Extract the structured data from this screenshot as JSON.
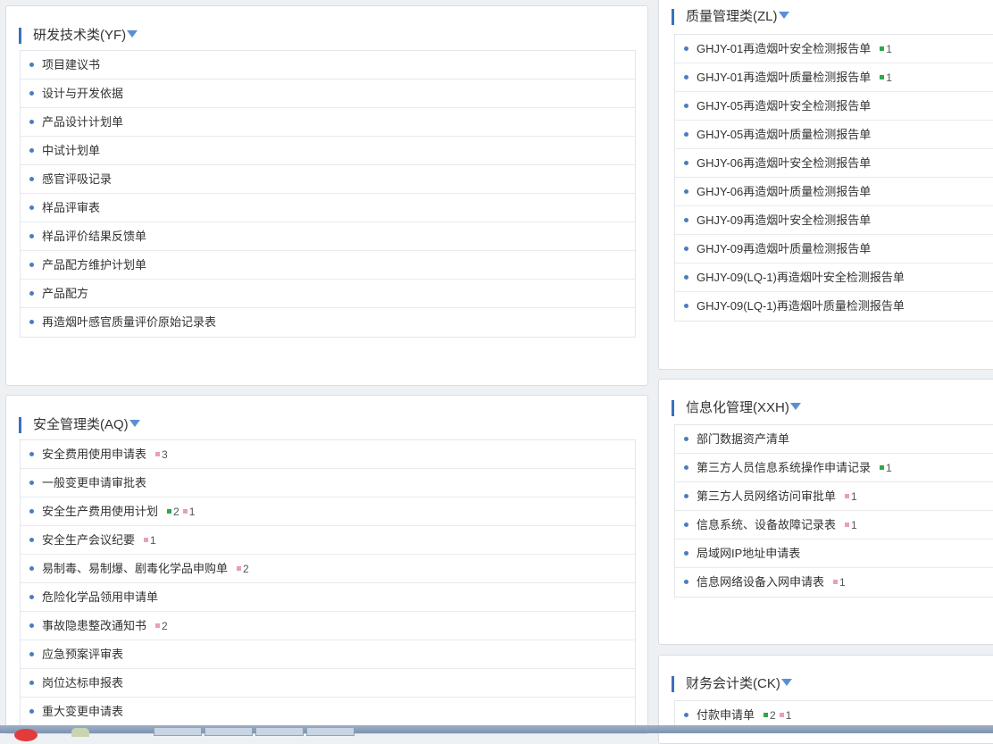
{
  "rd": {
    "title": "研发技术类(YF)",
    "items": [
      {
        "label": "项目建议书",
        "badges": []
      },
      {
        "label": "设计与开发依据",
        "badges": []
      },
      {
        "label": "产品设计计划单",
        "badges": []
      },
      {
        "label": "中试计划单",
        "badges": []
      },
      {
        "label": "感官评吸记录",
        "badges": []
      },
      {
        "label": "样品评审表",
        "badges": []
      },
      {
        "label": "样品评价结果反馈单",
        "badges": []
      },
      {
        "label": "产品配方维护计划单",
        "badges": []
      },
      {
        "label": "产品配方",
        "badges": []
      },
      {
        "label": "再造烟叶感官质量评价原始记录表",
        "badges": []
      }
    ]
  },
  "quality": {
    "title": "质量管理类(ZL)",
    "items": [
      {
        "label": "GHJY-01再造烟叶安全检测报告单",
        "badges": [
          {
            "color": "green",
            "count": "1"
          }
        ]
      },
      {
        "label": "GHJY-01再造烟叶质量检测报告单",
        "badges": [
          {
            "color": "green",
            "count": "1"
          }
        ]
      },
      {
        "label": "GHJY-05再造烟叶安全检测报告单",
        "badges": []
      },
      {
        "label": "GHJY-05再造烟叶质量检测报告单",
        "badges": []
      },
      {
        "label": "GHJY-06再造烟叶安全检测报告单",
        "badges": []
      },
      {
        "label": "GHJY-06再造烟叶质量检测报告单",
        "badges": []
      },
      {
        "label": "GHJY-09再造烟叶安全检测报告单",
        "badges": []
      },
      {
        "label": "GHJY-09再造烟叶质量检测报告单",
        "badges": []
      },
      {
        "label": "GHJY-09(LQ-1)再造烟叶安全检测报告单",
        "badges": []
      },
      {
        "label": "GHJY-09(LQ-1)再造烟叶质量检测报告单",
        "badges": []
      }
    ]
  },
  "safety": {
    "title": "安全管理类(AQ)",
    "items": [
      {
        "label": "安全费用使用申请表",
        "badges": [
          {
            "color": "pink",
            "count": "3"
          }
        ]
      },
      {
        "label": "一般变更申请审批表",
        "badges": []
      },
      {
        "label": "安全生产费用使用计划",
        "badges": [
          {
            "color": "green",
            "count": "2"
          },
          {
            "color": "pink",
            "count": "1"
          }
        ]
      },
      {
        "label": "安全生产会议纪要",
        "badges": [
          {
            "color": "pink",
            "count": "1"
          }
        ]
      },
      {
        "label": "易制毒、易制爆、剧毒化学品申购单",
        "badges": [
          {
            "color": "pink",
            "count": "2"
          }
        ]
      },
      {
        "label": "危险化学品领用申请单",
        "badges": []
      },
      {
        "label": "事故隐患整改通知书",
        "badges": [
          {
            "color": "pink",
            "count": "2"
          }
        ]
      },
      {
        "label": "应急预案评审表",
        "badges": []
      },
      {
        "label": "岗位达标申报表",
        "badges": []
      },
      {
        "label": "重大变更申请表",
        "badges": []
      }
    ]
  },
  "it": {
    "title": "信息化管理(XXH)",
    "items": [
      {
        "label": "部门数据资产清单",
        "badges": []
      },
      {
        "label": "第三方人员信息系统操作申请记录",
        "badges": [
          {
            "color": "green",
            "count": "1"
          }
        ]
      },
      {
        "label": "第三方人员网络访问审批单",
        "badges": [
          {
            "color": "pink",
            "count": "1"
          }
        ]
      },
      {
        "label": "信息系统、设备故障记录表",
        "badges": [
          {
            "color": "pink",
            "count": "1"
          }
        ]
      },
      {
        "label": "局域网IP地址申请表",
        "badges": []
      },
      {
        "label": "信息网络设备入网申请表",
        "badges": [
          {
            "color": "pink",
            "count": "1"
          }
        ]
      }
    ]
  },
  "finance": {
    "title": "财务会计类(CK)",
    "items": [
      {
        "label": "付款申请单",
        "badges": [
          {
            "color": "green",
            "count": "2"
          },
          {
            "color": "pink",
            "count": "1"
          }
        ]
      }
    ]
  },
  "colors": {
    "accent": "#3a6fbd",
    "green": "#2da84a",
    "pink": "#e8a0b4"
  }
}
